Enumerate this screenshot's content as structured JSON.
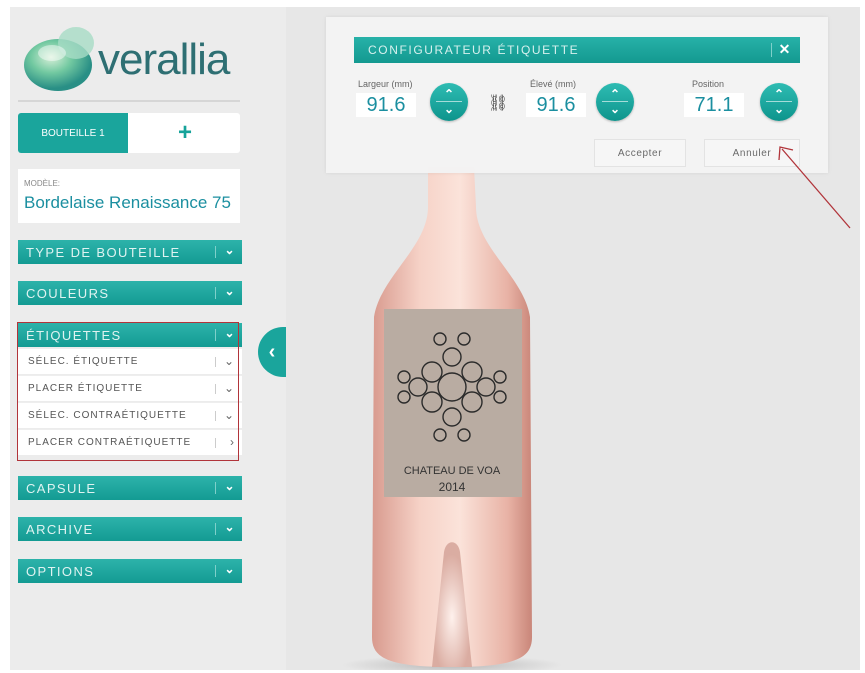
{
  "brand": {
    "logo_text": "verallia"
  },
  "tabs": {
    "active": "BOUTEILLE 1",
    "add": "+"
  },
  "model": {
    "label": "MODÈLE:",
    "value": "Bordelaise Renaissance 75"
  },
  "menu": {
    "type_bouteille": "TYPE DE BOUTEILLE",
    "couleurs": "COULEURS",
    "etiquettes": "ÉTIQUETTES",
    "sub": [
      {
        "label": "SÉLEC. ÉTIQUETTE",
        "chev": "⌄"
      },
      {
        "label": "PLACER ÉTIQUETTE",
        "chev": "⌄"
      },
      {
        "label": "SÉLEC. CONTRAÉTIQUETTE",
        "chev": "⌄"
      },
      {
        "label": "PLACER CONTRAÉTIQUETTE",
        "chev": "›"
      }
    ],
    "capsule": "CAPSULE",
    "archive": "ARCHIVE",
    "options": "OPTIONS"
  },
  "configurator": {
    "title": "CONFIGURATEUR ÉTIQUETTE",
    "close": "✕",
    "largeur_label": "Largeur (mm)",
    "largeur_value": "91.6",
    "eleve_label": "Élevé (mm)",
    "eleve_value": "91.6",
    "position_label": "Position",
    "position_value": "71.1",
    "accept": "Accepter",
    "cancel": "Annuler"
  },
  "label": {
    "line1": "CHATEAU DE VOA",
    "line2": "2014"
  },
  "colors": {
    "accent": "#1aa59c",
    "highlight": "#b1343a",
    "model_text": "#1b8fa0",
    "bottle": "#f0c4b8"
  },
  "icons": [
    "chevron-down-icon",
    "chevron-right-icon",
    "chevron-left-icon",
    "close-icon",
    "link-chain-icon",
    "plus-icon",
    "stepper-up-down-icon"
  ]
}
